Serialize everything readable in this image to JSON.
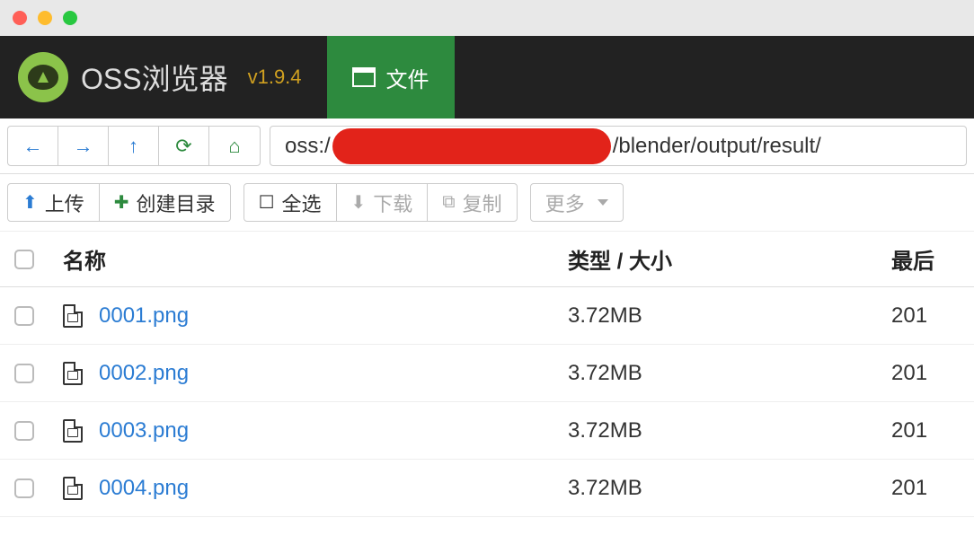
{
  "app": {
    "title": "OSS浏览器",
    "version": "v1.9.4"
  },
  "tabs": {
    "files_label": "文件"
  },
  "address": {
    "prefix": "oss:/",
    "suffix": "/blender/output/result/"
  },
  "actions": {
    "upload": "上传",
    "mkdir": "创建目录",
    "select_all": "全选",
    "download": "下载",
    "copy": "复制",
    "more": "更多"
  },
  "columns": {
    "name": "名称",
    "type_size": "类型 / 大小",
    "modified": "最后"
  },
  "files": [
    {
      "name": "0001.png",
      "size": "3.72MB",
      "date": "201"
    },
    {
      "name": "0002.png",
      "size": "3.72MB",
      "date": "201"
    },
    {
      "name": "0003.png",
      "size": "3.72MB",
      "date": "201"
    },
    {
      "name": "0004.png",
      "size": "3.72MB",
      "date": "201"
    }
  ]
}
